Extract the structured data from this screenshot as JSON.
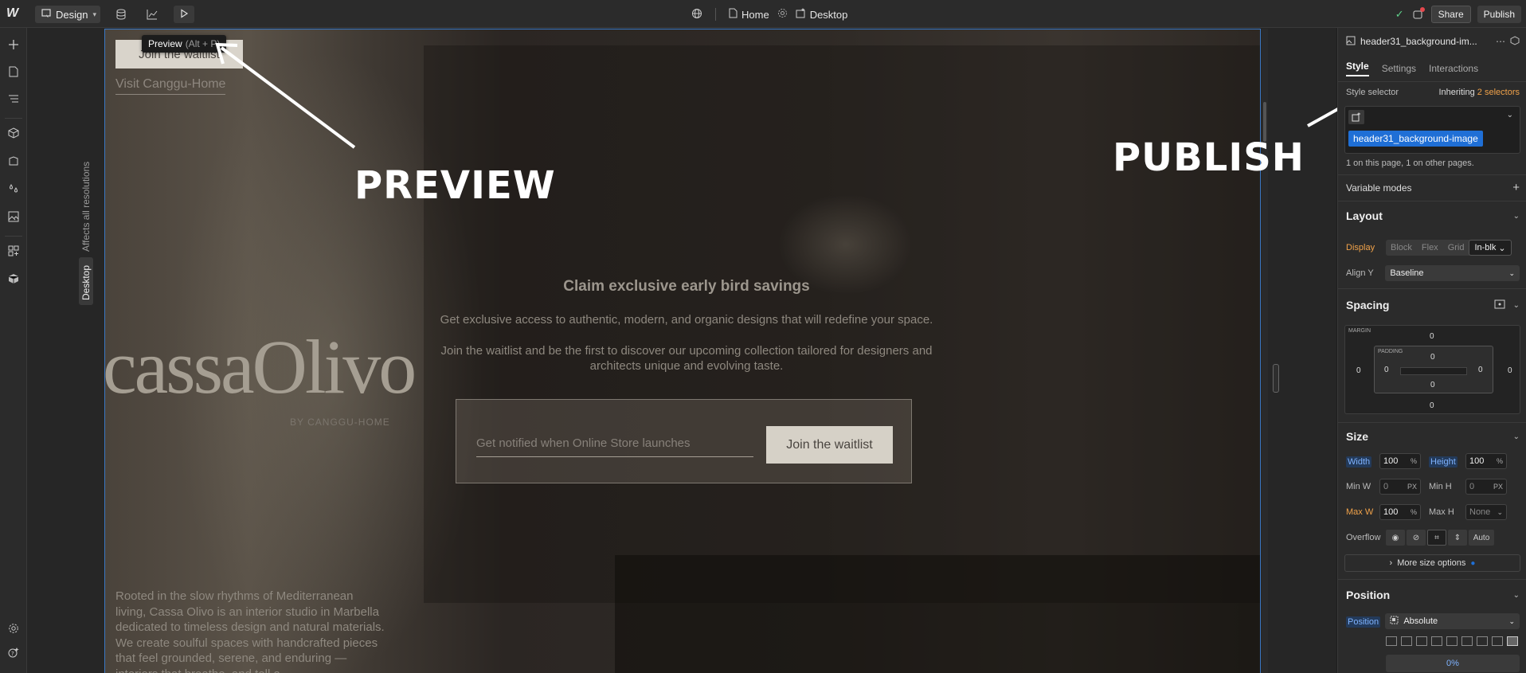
{
  "topbar": {
    "mode_label": "Design",
    "page_label": "Home",
    "breakpoint_label": "Desktop",
    "share_label": "Share",
    "publish_label": "Publish"
  },
  "tooltip": {
    "label": "Preview",
    "shortcut": "(Alt + P)"
  },
  "canvas": {
    "side_label": "Affects all resolutions",
    "desktop_label": "Desktop"
  },
  "site": {
    "top_button": "Join the waitlist",
    "visit_link": "Visit Canggu-Home",
    "hero_title": "Claim exclusive early bird savings",
    "hero_p1": "Get exclusive access to authentic, modern, and organic designs that will redefine your space.",
    "hero_p2": "Join the waitlist and be the first to discover our upcoming collection tailored for designers and architects unique and evolving taste.",
    "input_placeholder": "Get notified when Online Store launches",
    "form_button": "Join the waitlist",
    "brand": "cassaOlivo",
    "brand_sub": "BY CANGGU-HOME",
    "about": "Rooted in the slow rhythms of Mediterranean living, Cassa Olivo is an interior studio in Marbella dedicated to timeless design and natural materials. We create soulful spaces with handcrafted pieces that feel grounded, serene, and enduring — interiors that breathe, and tell a"
  },
  "annotations": {
    "preview": "PREVIEW",
    "publish": "PUBLISH"
  },
  "panel": {
    "element_name": "header31_background-im...",
    "tabs": [
      "Style",
      "Settings",
      "Interactions"
    ],
    "style_selector_label": "Style selector",
    "inheriting_label": "Inheriting",
    "inheriting_count": "2 selectors",
    "selector_chip": "header31_background-image",
    "usage_text": "1 on this page, 1 on other pages.",
    "variable_modes": "Variable modes",
    "layout": {
      "title": "Layout",
      "display_label": "Display",
      "display_options": [
        "Block",
        "Flex",
        "Grid",
        "In-blk"
      ],
      "aligny_label": "Align Y",
      "aligny_value": "Baseline"
    },
    "spacing": {
      "title": "Spacing",
      "margin_label": "MARGIN",
      "padding_label": "PADDING",
      "margin_top": "0",
      "margin_right": "0",
      "margin_bottom": "0",
      "margin_left": "0",
      "padding_top": "0",
      "padding_right": "0",
      "padding_bottom": "0",
      "padding_left": "0"
    },
    "size": {
      "title": "Size",
      "width_label": "Width",
      "width_value": "100",
      "width_unit": "%",
      "height_label": "Height",
      "height_value": "100",
      "height_unit": "%",
      "minw_label": "Min W",
      "minw_value": "0",
      "minw_unit": "PX",
      "minh_label": "Min H",
      "minh_value": "0",
      "minh_unit": "PX",
      "maxw_label": "Max W",
      "maxw_value": "100",
      "maxw_unit": "%",
      "maxh_label": "Max H",
      "maxh_value": "None",
      "overflow_label": "Overflow",
      "overflow_auto": "Auto",
      "more_label": "More size options"
    },
    "position": {
      "title": "Position",
      "label": "Position",
      "value": "Absolute",
      "offset_value": "0%"
    }
  },
  "colors": {
    "accent_blue": "#1f6fd6",
    "accent_orange": "#f0a24a",
    "success_green": "#5fd08a"
  }
}
